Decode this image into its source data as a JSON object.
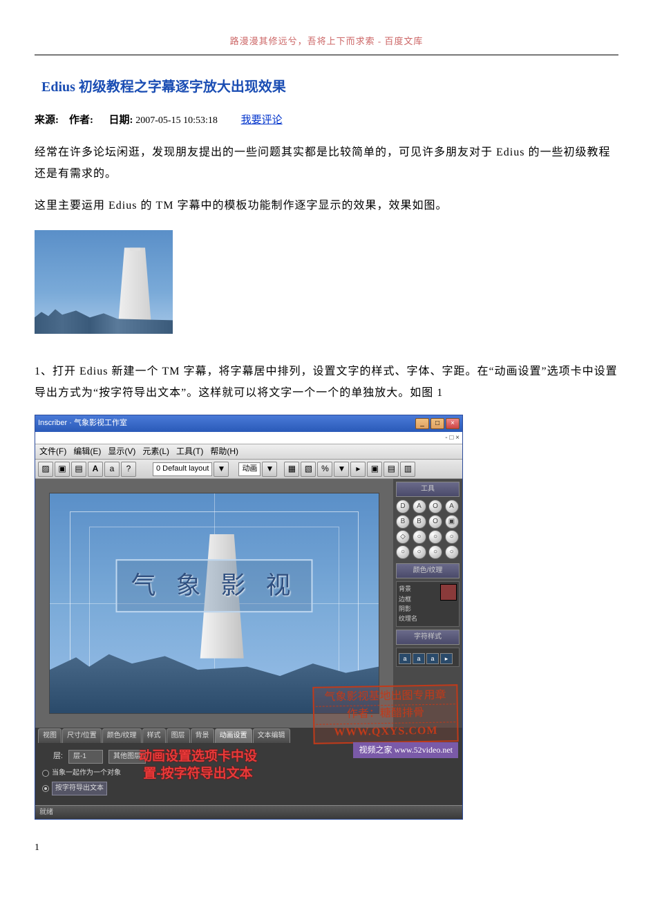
{
  "header": "路漫漫其修远兮，吾将上下而求索 - 百度文库",
  "title": "Edius 初级教程之字幕逐字放大出现效果",
  "meta": {
    "source_label": "来源:",
    "author_label": "作者:",
    "date_label": "日期:",
    "date_value": "2007-05-15 10:53:18",
    "comment_link": "我要评论"
  },
  "para1": "经常在许多论坛闲逛，发现朋友提出的一些问题其实都是比较简单的，可见许多朋友对于 Edius 的一些初级教程还是有需求的。",
  "para2": "这里主要运用 Edius 的 TM 字幕中的模板功能制作逐字显示的效果，效果如图。",
  "para3": "1、打开 Edius 新建一个 TM 字幕，将字幕居中排列，设置文字的样式、字体、字距。在“动画设置”选项卡中设置导出方式为“按字符导出文本”。这样就可以将文字一个一个的单独放大。如图 1",
  "app": {
    "titlebar": "Inscriber · 气象影视工作室",
    "submenu": "- □ ×",
    "menus": [
      "文件(F)",
      "编辑(E)",
      "显示(V)",
      "元素(L)",
      "工具(T)",
      "帮助(H)"
    ],
    "toolbar": {
      "layout_label": "0 Default layout",
      "anim_label": "动画"
    },
    "right": {
      "tools_title": "工具",
      "buttons": [
        "D",
        "A",
        "O",
        "A",
        "B",
        "B",
        "O",
        "▣",
        "◇",
        "○",
        "○",
        "○",
        "○",
        "○",
        "○",
        "○"
      ],
      "color_title": "颜色/纹理",
      "color_rows": [
        "背景",
        "边框",
        "阴影",
        "纹理名"
      ],
      "style_title": "字符样式"
    },
    "canvas_text": "气 象 影 视",
    "tabs": [
      "视图",
      "尺寸/位置",
      "颜色/纹理",
      "样式",
      "图层",
      "背景",
      "动画设置",
      "文本编辑"
    ],
    "tabs_active_index": 6,
    "bottom": {
      "layer_label": "层:",
      "layer_value": "层-1",
      "other_btn": "其他图层",
      "radio1": "当象一起作为一个对象",
      "radio2": "按字符导出文本",
      "overlay": "动画设置选项卡中设\n置-按字符导出文本"
    },
    "stamp": {
      "line1": "气象影视基地出图专用章",
      "line2": "作者：糖醋排骨",
      "line3": "WWW.QXYS.COM"
    },
    "watermark": "视频之家 www.52video.net",
    "status": "就绪"
  },
  "page_number": "1"
}
